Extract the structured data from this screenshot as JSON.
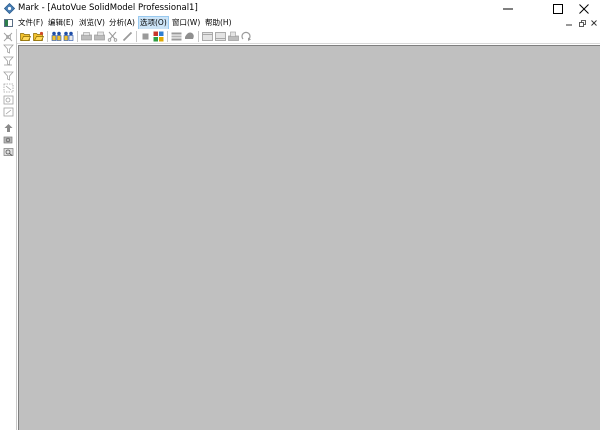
{
  "window": {
    "title": "Mark - [AutoVue SolidModel Professional1]",
    "app_icon": "autovue-diamond-icon",
    "controls": [
      "minimize-icon",
      "maximize-icon",
      "close-icon"
    ]
  },
  "menubar": {
    "items": [
      {
        "label": "文件(F)"
      },
      {
        "label": "编辑(E)"
      },
      {
        "label": "浏览(V)"
      },
      {
        "label": "分析(A)"
      },
      {
        "label": "选项(O)",
        "active": true
      },
      {
        "label": "窗口(W)"
      },
      {
        "label": "帮助(H)"
      }
    ],
    "mdi_controls": [
      "mdi-minimize-icon",
      "mdi-restore-icon",
      "mdi-close-icon"
    ]
  },
  "toolbar": {
    "buttons": [
      {
        "icon": "open-folder-icon",
        "enabled": true
      },
      {
        "icon": "open-recent-folder-icon",
        "enabled": true
      },
      {
        "icon": "markup-people-icon",
        "enabled": true
      },
      {
        "icon": "markup-people-alt-icon",
        "enabled": true
      },
      {
        "icon": "print-icon",
        "enabled": false
      },
      {
        "icon": "print-preview-icon",
        "enabled": false
      },
      {
        "icon": "cut-icon",
        "enabled": false
      },
      {
        "icon": "pencil-icon",
        "enabled": false
      },
      {
        "icon": "stop-icon",
        "enabled": false
      },
      {
        "icon": "tile-icon",
        "enabled": true
      },
      {
        "icon": "layers-icon",
        "enabled": false
      },
      {
        "icon": "shape-icon",
        "enabled": false
      },
      {
        "icon": "fit-page-icon",
        "enabled": false
      },
      {
        "icon": "fit-width-icon",
        "enabled": false
      },
      {
        "icon": "print-setup-icon",
        "enabled": false
      },
      {
        "icon": "rotate-icon",
        "enabled": false
      }
    ]
  },
  "lefttoolbar": {
    "buttons": [
      {
        "icon": "select-icon"
      },
      {
        "icon": "funnel-icon"
      },
      {
        "icon": "funnel-alt-icon"
      },
      {
        "icon": "filter-icon"
      },
      {
        "icon": "box-select-icon"
      },
      {
        "icon": "box-zoom-icon"
      },
      {
        "icon": "box-pan-icon"
      },
      {
        "icon": "arrow-up-icon"
      },
      {
        "icon": "magnify-icon"
      },
      {
        "icon": "zoom-window-icon"
      }
    ]
  },
  "colors": {
    "workspace": "#c0c0c0",
    "active_menu": "#cce4f7",
    "enabled_icon": "#e0a800",
    "disabled_icon": "#9a9a9a"
  }
}
